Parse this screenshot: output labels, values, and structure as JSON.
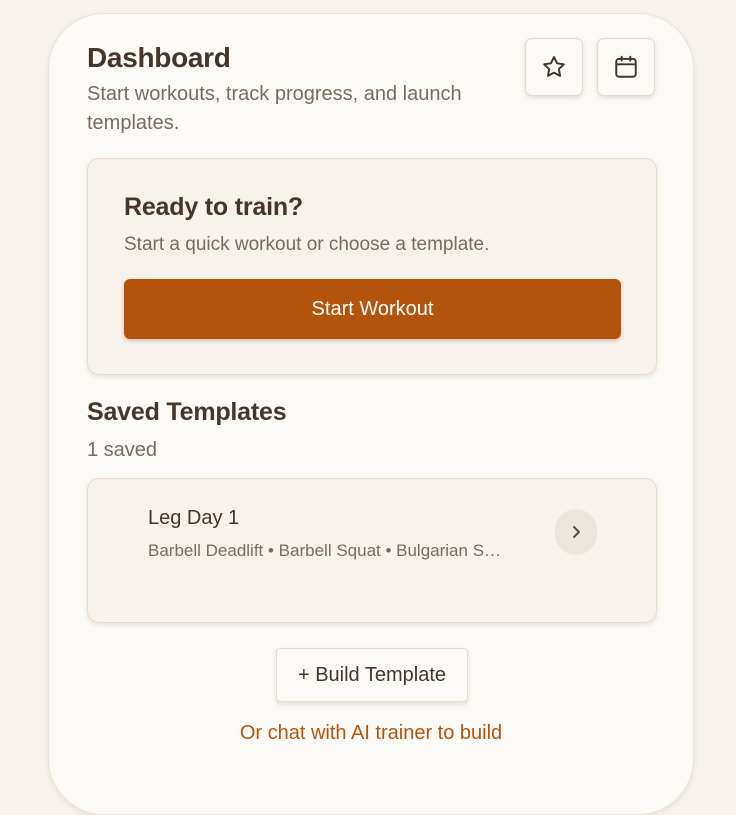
{
  "header": {
    "title": "Dashboard",
    "subtitle": "Start workouts, track progress, and launch templates."
  },
  "toolbar": {
    "favorites_icon": "star-icon",
    "calendar_icon": "calendar-icon"
  },
  "hero": {
    "title": "Ready to train?",
    "subtitle": "Start a quick workout or choose a template.",
    "start_label": "Start Workout"
  },
  "templates": {
    "title": "Saved Templates",
    "count": "1 saved",
    "items": [
      {
        "name": "Leg Day 1",
        "exercises": "Barbell Deadlift • Barbell Squat • Bulgarian S…",
        "open_icon": "chevron-right-icon"
      }
    ]
  },
  "actions": {
    "build_label": "+ Build Template",
    "ai_link": "Or chat with AI trainer to build"
  },
  "colors": {
    "accent": "#b4540c",
    "text": "#46352a",
    "muted": "#7a6b60",
    "background": "#f7f2ec",
    "card": "#f8f2ec"
  }
}
